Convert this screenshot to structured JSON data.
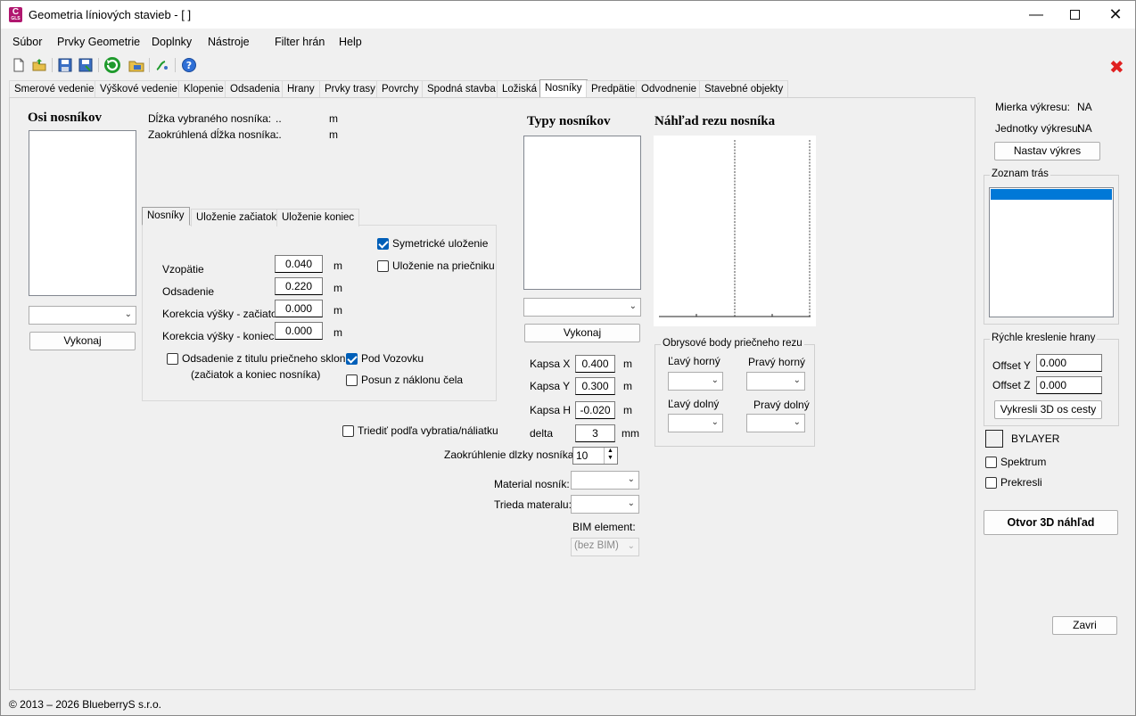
{
  "window": {
    "title": "Geometria líniových stavieb - [ ]",
    "app_icon_letter": "C",
    "app_icon_sub": "GLS"
  },
  "menu": [
    "Súbor",
    "Prvky Geometrie",
    "Doplnky",
    "Nástroje",
    "Filter hrán",
    "Help"
  ],
  "tabs": [
    "Smerové vedenie",
    "Výškové vedenie",
    "Klopenie",
    "Odsadenia",
    "Hrany",
    "Prvky trasy",
    "Povrchy",
    "Spodná stavba",
    "Ložiská",
    "Nosníky",
    "Predpätie",
    "Odvodnenie",
    "Stavebné objekty"
  ],
  "active_tab": "Nosníky",
  "left": {
    "title": "Osi nosníkov",
    "run_button": "Vykonaj"
  },
  "info": {
    "length_label": "Dĺžka vybraného nosníka:",
    "length_value": "..",
    "length_unit": "m",
    "round_label": "Zaokrúhlená dĺžka nosníka:",
    "round_value": "..",
    "round_unit": "m"
  },
  "subtabs": [
    "Nosníky",
    "Uloženie začiatok",
    "Uloženie koniec"
  ],
  "form": {
    "sym_label": "Symetrické uloženie",
    "crossbeam_label": "Uloženie na priečniku",
    "vzopatie_label": "Vzopätie",
    "vzopatie_value": "0.040",
    "odsadenie_label": "Odsadenie",
    "odsadenie_value": "0.220",
    "kor_zac_label": "Korekcia výšky - začiatok",
    "kor_zac_value": "0.000",
    "kor_kon_label": "Korekcia výšky - koniec",
    "kor_kon_value": "0.000",
    "unit": "m",
    "offset_slope_label": "Odsadenie z titulu priečneho sklonu",
    "offset_slope_label2": "(začiatok a koniec nosníka)",
    "pod_vozovku_label": "Pod Vozovku",
    "posun_label": "Posun z náklonu čela"
  },
  "sort_label": "Triediť podľa vybratia/náliatku",
  "rounding": {
    "label": "Zaokrúhlenie dlzky nosníka",
    "value": "10"
  },
  "material_label": "Material nosník:",
  "trieda_label": "Trieda materalu:",
  "bim_label": "BIM element:",
  "bim_value": "(bez BIM)",
  "types": {
    "title": "Typy nosníkov",
    "run_button": "Vykonaj",
    "kapsa_x_label": "Kapsa X",
    "kapsa_x_value": "0.400",
    "kapsa_y_label": "Kapsa Y",
    "kapsa_y_value": "0.300",
    "kapsa_h_label": "Kapsa H",
    "kapsa_h_value": "-0.020",
    "delta_label": "delta",
    "delta_value": "3",
    "unit_m": "m",
    "unit_mm": "mm"
  },
  "preview": {
    "title": "Náhľad rezu nosníka"
  },
  "contour": {
    "title": "Obrysové body priečneho rezu",
    "tl": "Ľavý horný",
    "tr": "Pravý horný",
    "bl": "Ľavý dolný",
    "br": "Pravý dolný"
  },
  "right": {
    "scale_label": "Mierka výkresu:",
    "scale_value": "NA",
    "units_label": "Jednotky výkresu:",
    "units_value": "NA",
    "set_button": "Nastav výkres",
    "routes_title": "Zoznam trás",
    "quick_title": "Rýchle kreslenie hrany",
    "offset_y_label": "Offset Y",
    "offset_y_value": "0.000",
    "offset_z_label": "Offset Z",
    "offset_z_value": "0.000",
    "draw3d_button": "Vykresli 3D os cesty",
    "bylayer_label": "BYLAYER",
    "spektrum_label": "Spektrum",
    "prekresli_label": "Prekresli",
    "open3d_button": "Otvor 3D náhľad",
    "close_button": "Zavri"
  },
  "footer": "© 2013 – 2026 BlueberryS s.r.o.",
  "colors": {
    "accent": "#005fb8",
    "selection": "#0078d7",
    "close_red": "#e02020"
  }
}
